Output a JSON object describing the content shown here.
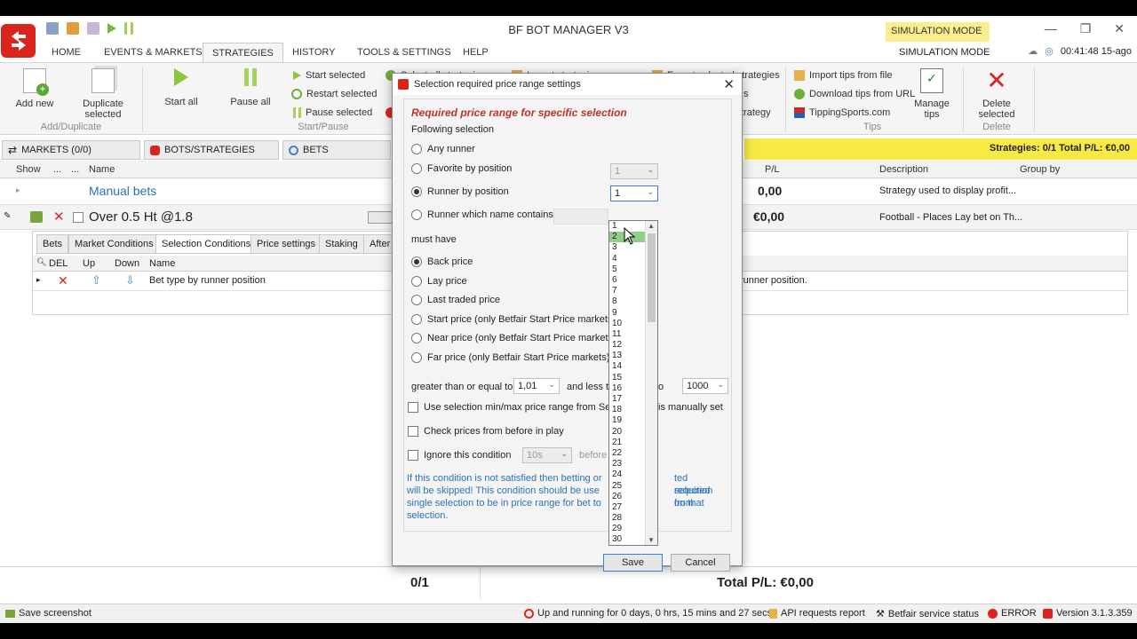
{
  "window": {
    "title": "BF BOT MANAGER V3",
    "simulation_tag": "SIMULATION MODE",
    "minimize": "—",
    "restore": "❐",
    "close": "✕"
  },
  "menu": {
    "items": [
      "HOME",
      "EVENTS & MARKETS",
      "STRATEGIES",
      "HISTORY",
      "TOOLS & SETTINGS",
      "HELP"
    ],
    "simulation_mode": "SIMULATION MODE",
    "clock": "00:41:48 15-ago"
  },
  "ribbon": {
    "add_new": "Add new",
    "duplicate_selected": "Duplicate selected",
    "group_add": "Add/Duplicate",
    "start_all": "Start all",
    "pause_all": "Pause all",
    "start_selected": "Start selected",
    "restart_selected": "Restart selected",
    "pause_selected": "Pause selected",
    "group_start": "Start/Pause",
    "select_all_partial": "Select all strategies",
    "import_partial": "Import strategies",
    "export_selected": "Export selected strategies",
    "partial_s": "s",
    "partial_strategy": "trategy",
    "import_tips": "Import tips from file",
    "download_tips": "Download tips from URL",
    "tipping_sports": "TippingSports.com",
    "group_tips": "Tips",
    "manage_tips": "Manage tips",
    "delete_selected": "Delete selected",
    "group_delete": "Delete"
  },
  "tabs": {
    "markets": "MARKETS (0/0)",
    "bots": "BOTS/STRATEGIES",
    "bets": "BETS",
    "summary": "Strategies: 0/1  Total P/L: €0,00"
  },
  "grid": {
    "headers": {
      "show": "Show",
      "dots1": "...",
      "dots2": "...",
      "name": "Name",
      "pl": "P/L",
      "description": "Description",
      "group_by": "Group by"
    },
    "manual_bets": {
      "name": "Manual bets",
      "pl": "0,00",
      "description": "Strategy used to display profit..."
    },
    "strategy_row": {
      "name": "Over 0.5 Ht @1.8",
      "pl": "€0,00",
      "description": "Football - Places Lay bet on Th..."
    }
  },
  "subtabs": [
    "Bets",
    "Market Conditions",
    "Selection Conditions",
    "Price settings",
    "Staking",
    "After"
  ],
  "subgrid": {
    "headers": {
      "del": "DEL",
      "up": "Up",
      "down": "Down",
      "name": "Name"
    },
    "row": {
      "name": "Bet type by runner position",
      "tail": "runner position."
    }
  },
  "totals": {
    "count": "0/1",
    "total": "Total P/L: €0,00"
  },
  "statusbar": {
    "save_screenshot": "Save screenshot",
    "uptime": "Up and running for 0 days, 0 hrs, 15 mins and 27 secs.",
    "api": "API requests report",
    "betfair": "Betfair service status",
    "error": "ERROR",
    "version": "Version 3.1.3.359"
  },
  "dialog": {
    "title": "Selection required price range settings",
    "heading": "Required price range for specific selection",
    "following_selection": "Following selection",
    "any_runner": "Any runner",
    "favorite_by_position": "Favorite by position",
    "favorite_value": "1",
    "runner_by_position": "Runner by position",
    "runner_value": "1",
    "runner_name_contains": "Runner which name contains",
    "must_have": "must have",
    "back_price": "Back price",
    "lay_price": "Lay price",
    "last_traded": "Last traded price",
    "start_price": "Start price (only Betfair Start Price markets)",
    "near_price": "Near price (only Betfair Start Price markets)",
    "far_price": "Far price (only Betfair Start Price markets)",
    "gte_label": "greater than or equal to",
    "gte_value": "1,01",
    "less_label": "and less th",
    "to_label": "o",
    "max_value": "1000",
    "use_minmax": "Use selection min/max price range from Selecti",
    "use_minmax_tail": "is manually set",
    "check_prices": "Check prices from before in play",
    "ignore_condition": "Ignore this condition",
    "ignore_value": "10s",
    "before_label": "before s",
    "info_line1": "If this condition is not satisfied then betting or",
    "info_line1_tail": "ted selection",
    "info_line2": "will be skipped! This condition should be use",
    "info_line2_tail": "required from",
    "info_line3": "single selection to be in price range for bet to",
    "info_line3_tail": "on that",
    "info_line4": "selection.",
    "save": "Save",
    "cancel": "Cancel"
  },
  "dropdown": {
    "options": [
      "1",
      "2",
      "3",
      "4",
      "5",
      "6",
      "7",
      "8",
      "9",
      "10",
      "11",
      "12",
      "13",
      "14",
      "15",
      "16",
      "17",
      "18",
      "19",
      "20",
      "21",
      "22",
      "23",
      "24",
      "25",
      "26",
      "27",
      "28",
      "29",
      "30"
    ],
    "highlighted": "2"
  }
}
